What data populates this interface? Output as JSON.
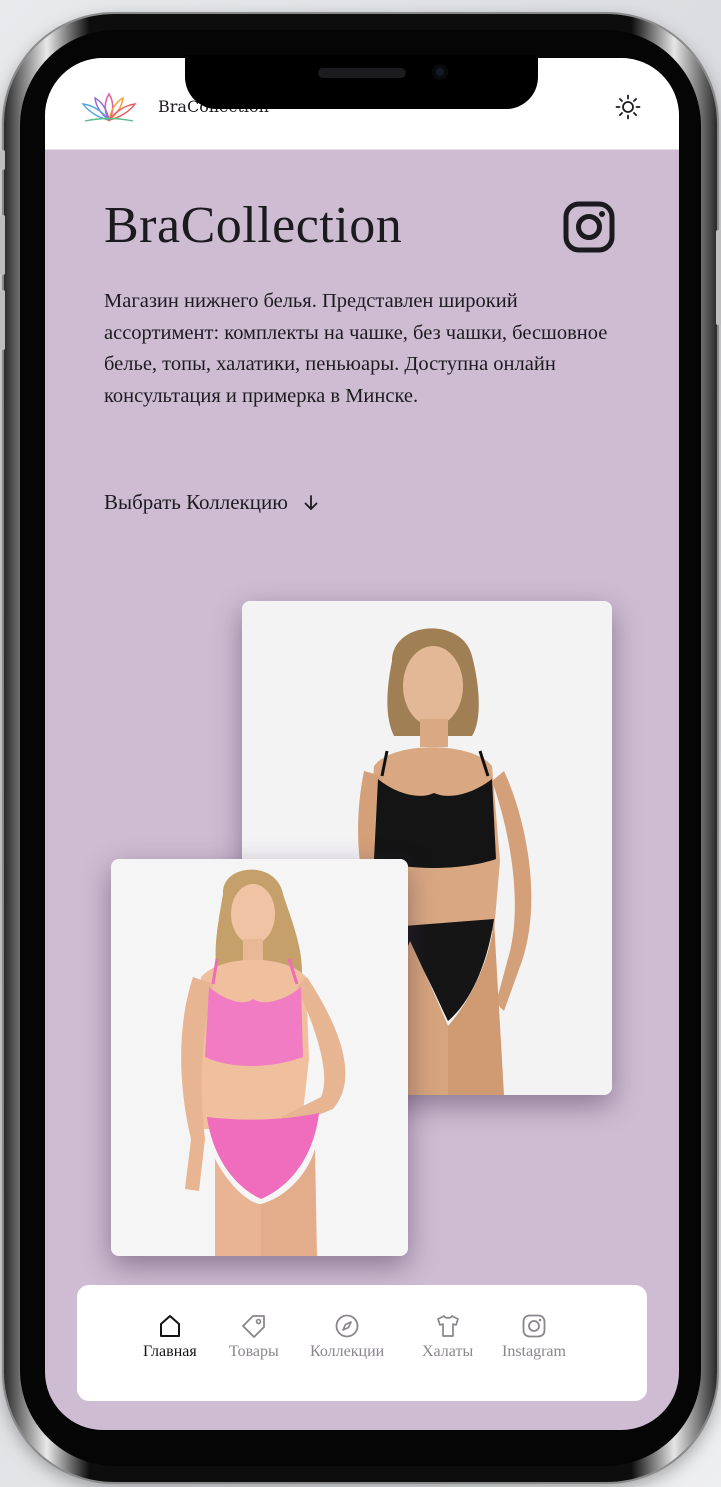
{
  "header": {
    "brand": "BraCollection",
    "logo_icon": "lotus-logo-icon",
    "theme_icon": "sun-icon"
  },
  "hero": {
    "title": "BraCollection",
    "instagram_icon": "instagram-icon",
    "description": "Магазин нижнего белья. Представлен широкий ассортимент: комплекты на чашке, без чашки, бесшовное белье, топы, халатики, пеньюары. Доступна онлайн консультация и примерка в Минске.",
    "choose_collection": "Выбрать Коллекцию",
    "choose_icon": "arrow-down-icon"
  },
  "photos": [
    {
      "subject": "model-black-set"
    },
    {
      "subject": "model-pink-set"
    }
  ],
  "nav": {
    "items": [
      {
        "label": "Главная",
        "icon": "home-icon",
        "active": true
      },
      {
        "label": "Товары",
        "icon": "tag-icon",
        "active": false
      },
      {
        "label": "Коллекции",
        "icon": "compass-icon",
        "active": false
      },
      {
        "label": "Халаты",
        "icon": "shirt-icon",
        "active": false
      },
      {
        "label": "Instagram",
        "icon": "instagram-icon",
        "active": false
      }
    ]
  },
  "colors": {
    "background": "#cdbcd2",
    "text": "#1e1b20",
    "nav_inactive": "#8a858c"
  }
}
